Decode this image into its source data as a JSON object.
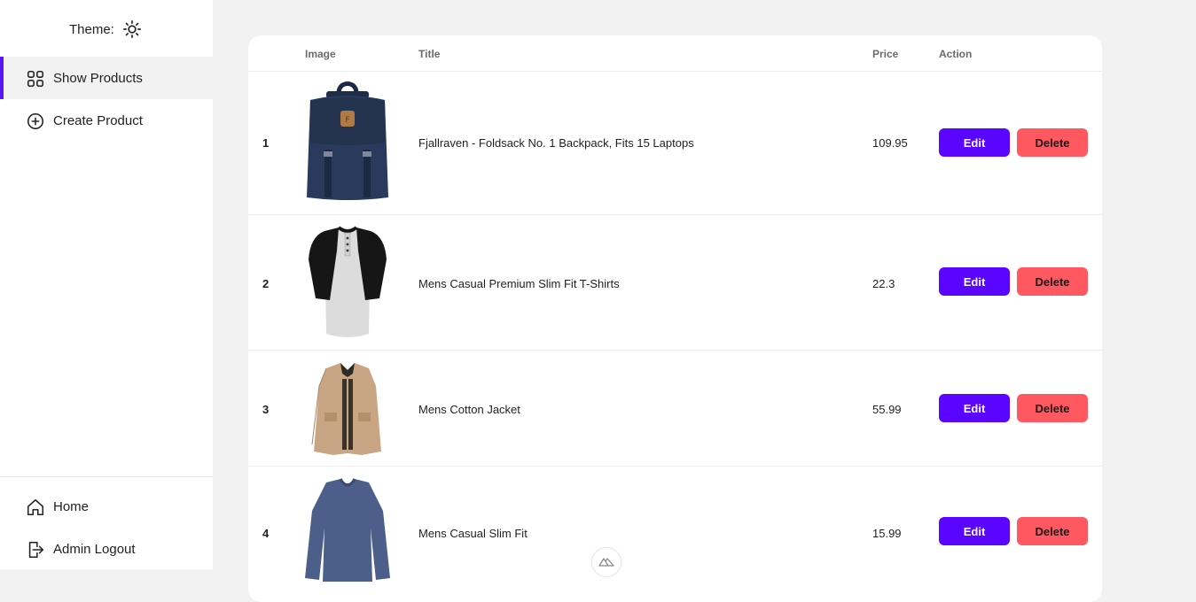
{
  "sidebar": {
    "theme_label": "Theme:",
    "nav": [
      {
        "label": "Show Products",
        "icon": "grid-icon",
        "active": true
      },
      {
        "label": "Create Product",
        "icon": "plus-circle-icon",
        "active": false
      }
    ],
    "bottom_nav": [
      {
        "label": "Home",
        "icon": "home-icon"
      },
      {
        "label": "Admin Logout",
        "icon": "logout-icon"
      }
    ]
  },
  "table": {
    "headers": {
      "index": "",
      "image": "Image",
      "title": "Title",
      "price": "Price",
      "action": "Action"
    },
    "rows": [
      {
        "num": "1",
        "title": "Fjallraven - Foldsack No. 1 Backpack, Fits 15 Laptops",
        "price": "109.95",
        "edit": "Edit",
        "delete": "Delete",
        "image": "backpack-image"
      },
      {
        "num": "2",
        "title": "Mens Casual Premium Slim Fit T-Shirts",
        "price": "22.3",
        "edit": "Edit",
        "delete": "Delete",
        "image": "raglan-tshirt-image"
      },
      {
        "num": "3",
        "title": "Mens Cotton Jacket",
        "price": "55.99",
        "edit": "Edit",
        "delete": "Delete",
        "image": "cotton-jacket-image"
      },
      {
        "num": "4",
        "title": "Mens Casual Slim Fit",
        "price": "15.99",
        "edit": "Edit",
        "delete": "Delete",
        "image": "long-sleeve-shirt-image"
      }
    ]
  },
  "colors": {
    "accent": "#5a05ff",
    "danger": "#ff5861",
    "background": "#f2f2f2"
  }
}
